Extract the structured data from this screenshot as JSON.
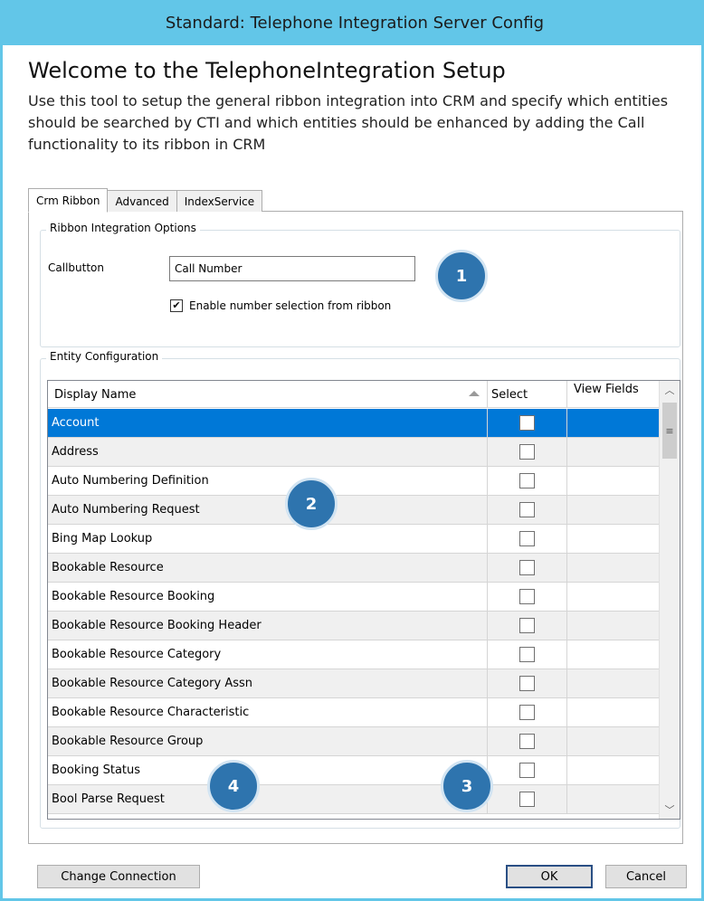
{
  "window": {
    "title": "Standard: Telephone Integration Server Config"
  },
  "welcome": {
    "title": "Welcome to the TelephoneIntegration Setup",
    "description": "Use this tool to setup the general ribbon integration into CRM and specify which entities should be searched by CTI and which entities should be enhanced by adding the Call functionality to its ribbon in CRM"
  },
  "tabs": [
    {
      "label": "Crm Ribbon",
      "active": true
    },
    {
      "label": "Advanced",
      "active": false
    },
    {
      "label": "IndexService",
      "active": false
    }
  ],
  "ribbon_options": {
    "legend": "Ribbon Integration Options",
    "callbutton_label": "Callbutton",
    "callbutton_value": "Call Number",
    "enable_selection_label": "Enable number selection from ribbon",
    "enable_selection_checked": true
  },
  "entity_config": {
    "legend": "Entity Configuration",
    "columns": [
      "Display Name",
      "Select",
      "View Fields"
    ],
    "rows": [
      {
        "name": "Account",
        "selected": true
      },
      {
        "name": "Address"
      },
      {
        "name": "Auto Numbering Definition"
      },
      {
        "name": "Auto Numbering Request"
      },
      {
        "name": "Bing Map Lookup"
      },
      {
        "name": "Bookable Resource"
      },
      {
        "name": "Bookable Resource Booking"
      },
      {
        "name": "Bookable Resource Booking Header"
      },
      {
        "name": "Bookable Resource Category"
      },
      {
        "name": "Bookable Resource Category Assn"
      },
      {
        "name": "Bookable Resource Characteristic"
      },
      {
        "name": "Bookable Resource Group"
      },
      {
        "name": "Booking Status"
      },
      {
        "name": "Bool Parse Request"
      }
    ]
  },
  "badges": [
    "1",
    "2",
    "3",
    "4"
  ],
  "buttons": {
    "change_connection": "Change Connection",
    "ok": "OK",
    "cancel": "Cancel"
  },
  "colors": {
    "titlebar": "#62c6e8",
    "selection": "#0078d7",
    "badge": "#2e74ae"
  }
}
